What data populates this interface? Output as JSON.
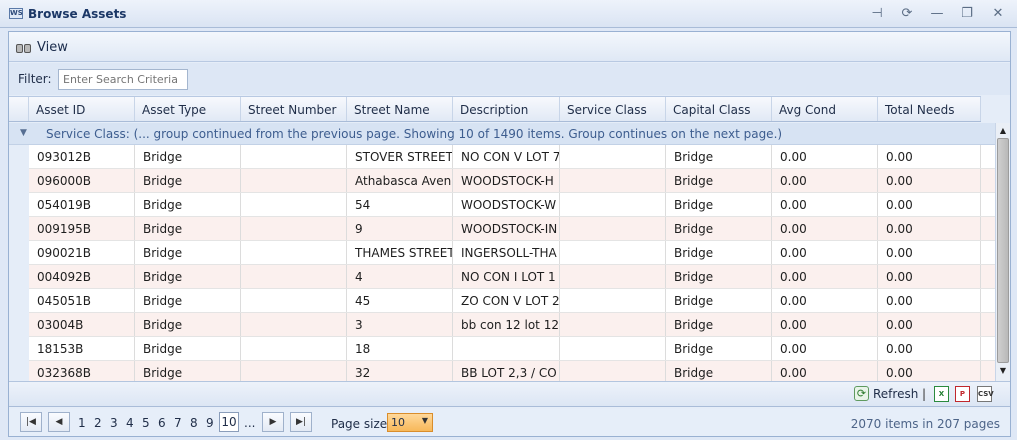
{
  "window": {
    "title": "Browse Assets",
    "app_icon": "WS"
  },
  "toolbar": {
    "view_label": "View"
  },
  "filter": {
    "label": "Filter:",
    "placeholder": "Enter Search Criteria"
  },
  "columns": [
    "Asset ID",
    "Asset Type",
    "Street Number",
    "Street Name",
    "Description",
    "Service Class",
    "Capital Class",
    "Avg Cond",
    "Total Needs"
  ],
  "group": {
    "text": "Service Class: (... group continued from the previous page. Showing 10 of 1490 items. Group continues on the next page.)"
  },
  "rows": [
    [
      "093012B",
      "Bridge",
      "",
      "STOVER STREET",
      "NO CON V LOT 7",
      "",
      "Bridge",
      "0.00",
      "0.00"
    ],
    [
      "096000B",
      "Bridge",
      "",
      "Athabasca Aven",
      "WOODSTOCK-H",
      "",
      "Bridge",
      "0.00",
      "0.00"
    ],
    [
      "054019B",
      "Bridge",
      "",
      "54",
      "WOODSTOCK-W",
      "",
      "Bridge",
      "0.00",
      "0.00"
    ],
    [
      "009195B",
      "Bridge",
      "",
      "9",
      "WOODSTOCK-IN",
      "",
      "Bridge",
      "0.00",
      "0.00"
    ],
    [
      "090021B",
      "Bridge",
      "",
      "THAMES STREET",
      "INGERSOLL-THA",
      "",
      "Bridge",
      "0.00",
      "0.00"
    ],
    [
      "004092B",
      "Bridge",
      "",
      "4",
      "NO CON I LOT 1",
      "",
      "Bridge",
      "0.00",
      "0.00"
    ],
    [
      "045051B",
      "Bridge",
      "",
      "45",
      "ZO CON V LOT 2",
      "",
      "Bridge",
      "0.00",
      "0.00"
    ],
    [
      "03004B",
      "Bridge",
      "",
      "3",
      "bb con 12 lot 12",
      "",
      "Bridge",
      "0.00",
      "0.00"
    ],
    [
      "18153B",
      "Bridge",
      "",
      "18",
      "",
      "",
      "Bridge",
      "0.00",
      "0.00"
    ],
    [
      "032368B",
      "Bridge",
      "",
      "32",
      "BB LOT 2,3 / CO",
      "",
      "Bridge",
      "0.00",
      "0.00"
    ]
  ],
  "actions": {
    "refresh_label": "Refresh",
    "separator": "|",
    "export_icons": [
      "excel-export-icon",
      "pdf-export-icon",
      "csv-export-icon"
    ]
  },
  "pager": {
    "pages": [
      "1",
      "2",
      "3",
      "4",
      "5",
      "6",
      "7",
      "8",
      "9",
      "10",
      "..."
    ],
    "current_page": "10",
    "page_size_label": "Page size:",
    "page_size": "10",
    "summary": "2070 items in 207 pages"
  },
  "colors": {
    "accent": "#f7b85a",
    "row_alt": "#fbf0ee",
    "header_bg": "#dfe8f6"
  }
}
